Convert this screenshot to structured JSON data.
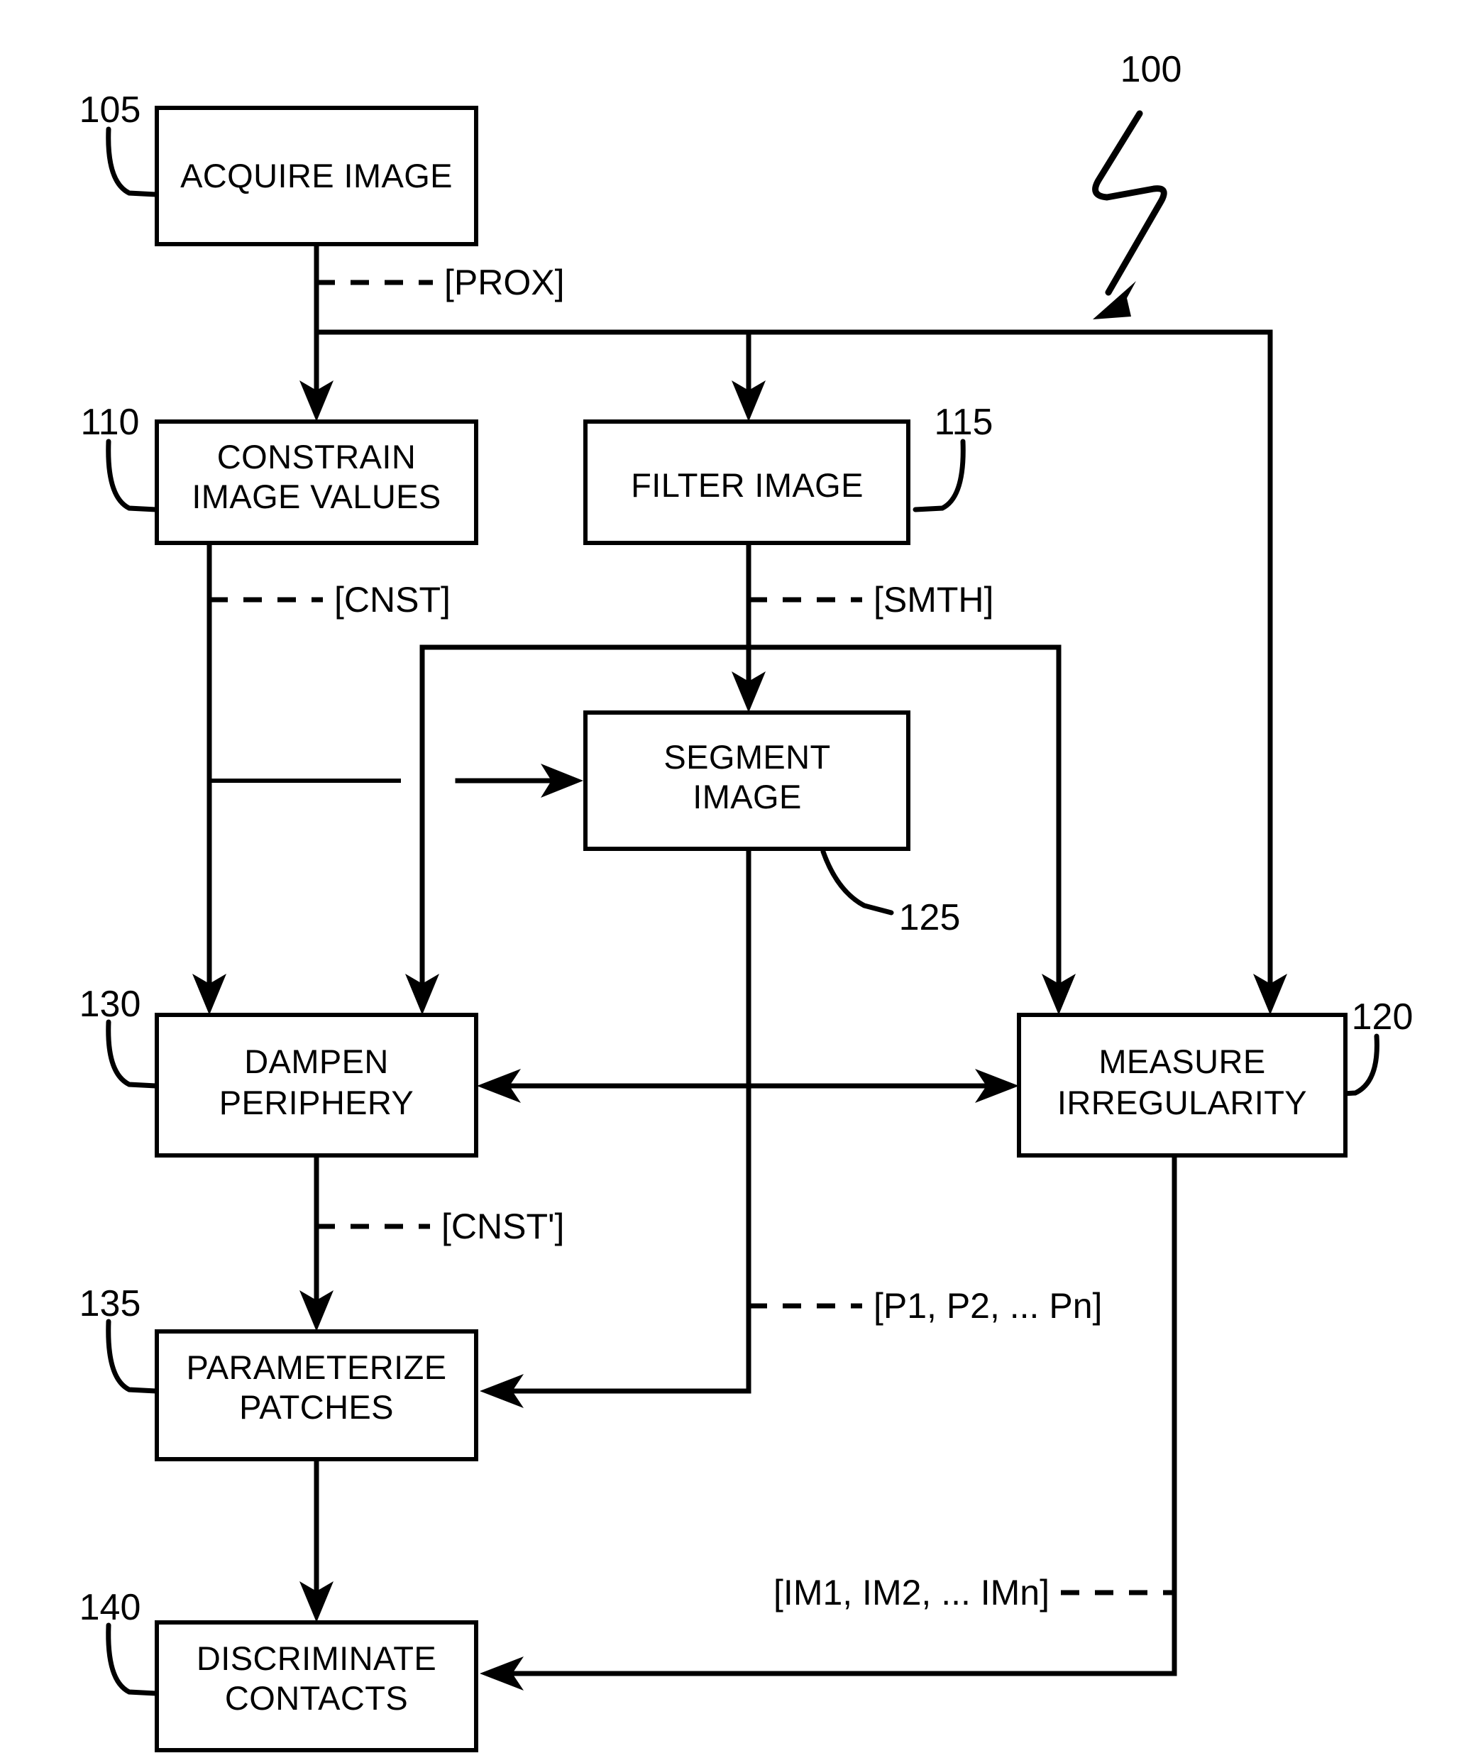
{
  "figure": {
    "reference_numeral": "100",
    "boxes": [
      {
        "id": "acquire",
        "numeral": "105",
        "lines": [
          "ACQUIRE IMAGE"
        ]
      },
      {
        "id": "constrain",
        "numeral": "110",
        "lines": [
          "CONSTRAIN",
          "IMAGE VALUES"
        ]
      },
      {
        "id": "filter",
        "numeral": "115",
        "lines": [
          "FILTER IMAGE"
        ]
      },
      {
        "id": "measure",
        "numeral": "120",
        "lines": [
          "MEASURE",
          "IRREGULARITY"
        ]
      },
      {
        "id": "segment",
        "numeral": "125",
        "lines": [
          "SEGMENT",
          "IMAGE"
        ]
      },
      {
        "id": "dampen",
        "numeral": "130",
        "lines": [
          "DAMPEN",
          "PERIPHERY"
        ]
      },
      {
        "id": "parameterize",
        "numeral": "135",
        "lines": [
          "PARAMETERIZE",
          "PATCHES"
        ]
      },
      {
        "id": "discriminate",
        "numeral": "140",
        "lines": [
          "DISCRIMINATE",
          "CONTACTS"
        ]
      }
    ],
    "signals": [
      {
        "id": "prox",
        "label": "[PROX]"
      },
      {
        "id": "cnst",
        "label": "[CNST]"
      },
      {
        "id": "smth",
        "label": "[SMTH]"
      },
      {
        "id": "cnstp",
        "label": "[CNST']"
      },
      {
        "id": "patches",
        "label": "[P1, P2, ... Pn]"
      },
      {
        "id": "irreg",
        "label": "[IM1, IM2, ... IMn]"
      }
    ]
  }
}
